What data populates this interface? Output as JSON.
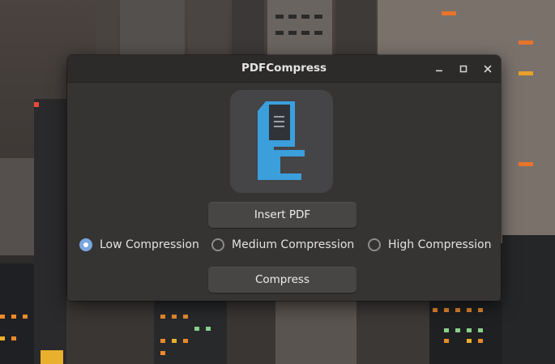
{
  "window": {
    "title": "PDFCompress"
  },
  "window_controls": {
    "minimize": "minimize-icon",
    "maximize": "maximize-icon",
    "close": "close-icon"
  },
  "logo": {
    "icon": "pdfcompress-logo-icon",
    "colors": {
      "blue": "#3b9fdc",
      "tile": "#454447",
      "doc": "#303338"
    }
  },
  "buttons": {
    "insert_label": "Insert PDF",
    "compress_label": "Compress"
  },
  "compression_options": [
    {
      "label": "Low Compression",
      "selected": true
    },
    {
      "label": "Medium Compression",
      "selected": false
    },
    {
      "label": "High Compression",
      "selected": false
    }
  ],
  "colors": {
    "accent": "#7ba6e0",
    "window_bg": "#353433",
    "titlebar_bg": "#2c2b2a",
    "button_bg": "#484644"
  }
}
